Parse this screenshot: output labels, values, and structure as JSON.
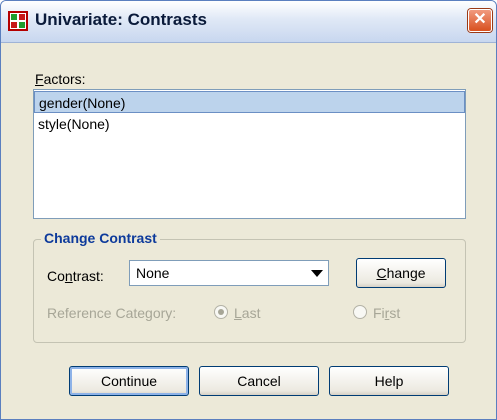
{
  "window": {
    "title": "Univariate: Contrasts"
  },
  "icons": {
    "app": "spss-app-icon",
    "close": "close-icon"
  },
  "factors": {
    "label_mnemonic": "F",
    "label_rest": "actors:",
    "items": [
      "gender(None)",
      "style(None)"
    ],
    "selected_index": 0
  },
  "change_contrast": {
    "title": "Change Contrast",
    "contrast_label_pre": "Co",
    "contrast_label_mnemonic": "n",
    "contrast_label_post": "trast:",
    "contrast_value": "None",
    "change_button_mnemonic": "C",
    "change_button_rest": "hange",
    "reference_label": "Reference Category:",
    "last_mnemonic": "L",
    "last_rest": "ast",
    "first_pre": "Fi",
    "first_mnemonic": "r",
    "first_post": "st",
    "reference_selected": "Last"
  },
  "buttons": {
    "continue": "Continue",
    "cancel": "Cancel",
    "help": "Help"
  },
  "colors": {
    "group_title": "#0d3a9b",
    "selection": "#bcd3ec",
    "disabled_text": "#a7a697"
  }
}
